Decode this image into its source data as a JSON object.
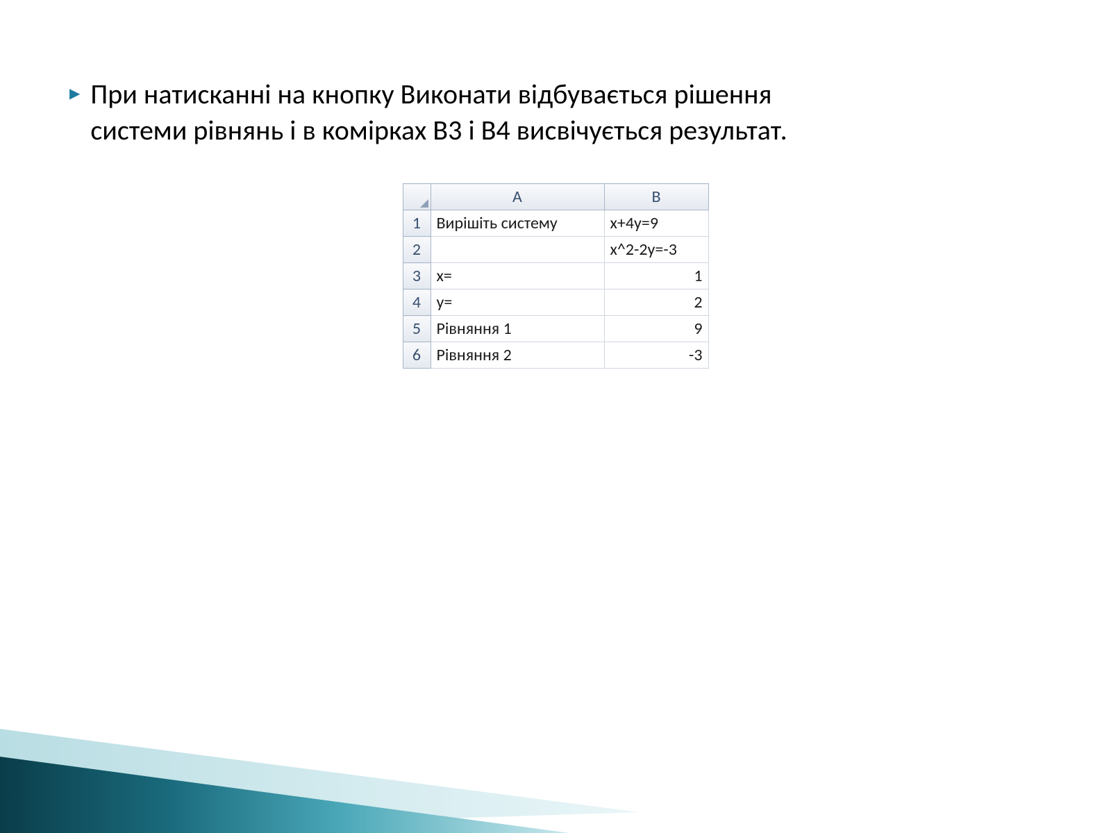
{
  "slide": {
    "text": "При натисканні на кнопку Виконати відбувається рішення системи рівнянь і в комірках B3 і B4 висвічується результат."
  },
  "spreadsheet": {
    "columns": [
      "A",
      "B"
    ],
    "rows": [
      {
        "n": "1",
        "a": "Вирішіть систему",
        "b": "x+4y=9",
        "b_align": "left"
      },
      {
        "n": "2",
        "a": "",
        "b": "x^2-2y=-3",
        "b_align": "left"
      },
      {
        "n": "3",
        "a": "x=",
        "b": "1",
        "b_align": "right"
      },
      {
        "n": "4",
        "a": "y=",
        "b": "2",
        "b_align": "right"
      },
      {
        "n": "5",
        "a": "Рівняння 1",
        "b": "9",
        "b_align": "right"
      },
      {
        "n": "6",
        "a": "Рівняння 2",
        "b": "-3",
        "b_align": "right"
      }
    ]
  }
}
